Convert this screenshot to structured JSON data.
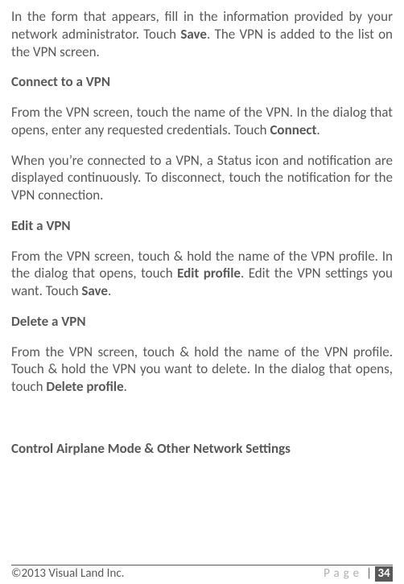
{
  "paragraphs": {
    "p1_a": "In the form that appears, fill in the information provided by your network administrator. Touch ",
    "p1_b": "Save",
    "p1_c": ". The VPN is added to the list on the VPN screen.",
    "h1": "Connect to a VPN",
    "p2_a": "From the VPN screen, touch the name of the VPN. In the dialog that opens, enter any requested credentials. Touch ",
    "p2_b": "Connect",
    "p2_c": ".",
    "p3": "When you’re connected to a VPN, a Status icon and notification are displayed continuously. To disconnect, touch the notification for the VPN connection.",
    "h2": "Edit a VPN",
    "p4_a": "From the VPN screen, touch & hold the name of the VPN profile. In the dialog that opens, touch ",
    "p4_b": "Edit profile",
    "p4_c": ". Edit the VPN settings you want. Touch ",
    "p4_d": "Save",
    "p4_e": ".",
    "h3": "Delete a VPN",
    "p5_a": "From the VPN screen, touch & hold the name of the VPN profile. Touch & hold the VPN you want to delete. In the dialog that opens, touch ",
    "p5_b": "Delete profile",
    "p5_c": ".",
    "h4": "Control Airplane Mode & Other Network Settings"
  },
  "footer": {
    "copyright": "©2013 Visual Land Inc.",
    "page_label": "Page",
    "page_sep": "|",
    "page_num": "34"
  }
}
